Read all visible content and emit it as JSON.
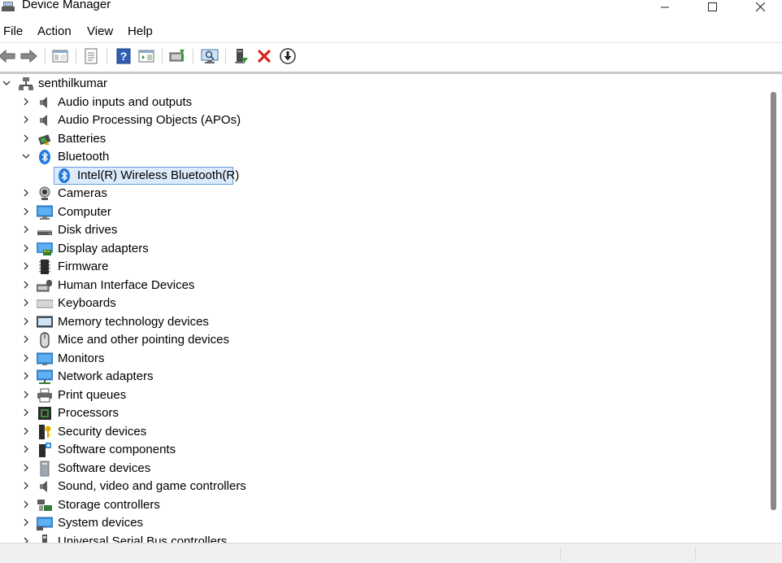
{
  "window": {
    "title": "Device Manager",
    "controls": [
      "minimize",
      "maximize",
      "close"
    ]
  },
  "menu": [
    "File",
    "Action",
    "View",
    "Help"
  ],
  "toolbar": [
    {
      "name": "back-icon"
    },
    {
      "name": "forward-icon"
    },
    {
      "name": "show-hide-console-tree-icon"
    },
    {
      "name": "properties-icon"
    },
    {
      "name": "help-icon"
    },
    {
      "name": "show-action-pane-icon"
    },
    {
      "name": "update-driver-icon"
    },
    {
      "name": "scan-hardware-changes-icon"
    },
    {
      "name": "add-legacy-hardware-icon"
    },
    {
      "name": "uninstall-device-icon"
    },
    {
      "name": "disable-device-icon"
    }
  ],
  "tree": {
    "root": "senthilkumar",
    "categories": [
      {
        "label": "Audio inputs and outputs",
        "icon": "speaker-icon"
      },
      {
        "label": "Audio Processing Objects (APOs)",
        "icon": "speaker-icon"
      },
      {
        "label": "Batteries",
        "icon": "battery-icon"
      },
      {
        "label": "Bluetooth",
        "icon": "bluetooth-icon",
        "expanded": true,
        "children": [
          {
            "label": "Intel(R) Wireless Bluetooth(R)",
            "icon": "bluetooth-icon",
            "selected": true
          }
        ]
      },
      {
        "label": "Cameras",
        "icon": "camera-icon"
      },
      {
        "label": "Computer",
        "icon": "computer-icon"
      },
      {
        "label": "Disk drives",
        "icon": "disk-drive-icon"
      },
      {
        "label": "Display adapters",
        "icon": "display-adapter-icon"
      },
      {
        "label": "Firmware",
        "icon": "firmware-icon"
      },
      {
        "label": "Human Interface Devices",
        "icon": "hid-icon"
      },
      {
        "label": "Keyboards",
        "icon": "keyboard-icon"
      },
      {
        "label": "Memory technology devices",
        "icon": "memory-icon"
      },
      {
        "label": "Mice and other pointing devices",
        "icon": "mouse-icon"
      },
      {
        "label": "Monitors",
        "icon": "monitor-icon"
      },
      {
        "label": "Network adapters",
        "icon": "network-adapter-icon"
      },
      {
        "label": "Print queues",
        "icon": "printer-icon"
      },
      {
        "label": "Processors",
        "icon": "processor-icon"
      },
      {
        "label": "Security devices",
        "icon": "security-device-icon"
      },
      {
        "label": "Software components",
        "icon": "software-component-icon"
      },
      {
        "label": "Software devices",
        "icon": "software-device-icon"
      },
      {
        "label": "Sound, video and game controllers",
        "icon": "speaker-icon"
      },
      {
        "label": "Storage controllers",
        "icon": "storage-controller-icon"
      },
      {
        "label": "System devices",
        "icon": "system-devices-icon"
      },
      {
        "label": "Universal Serial Bus controllers",
        "icon": "usb-icon"
      }
    ]
  },
  "colors": {
    "selection_bg": "#dcebfb",
    "selection_border": "#6a9ed8",
    "bluetooth_blue": "#1e7ae0",
    "delete_red": "#d9241c"
  }
}
